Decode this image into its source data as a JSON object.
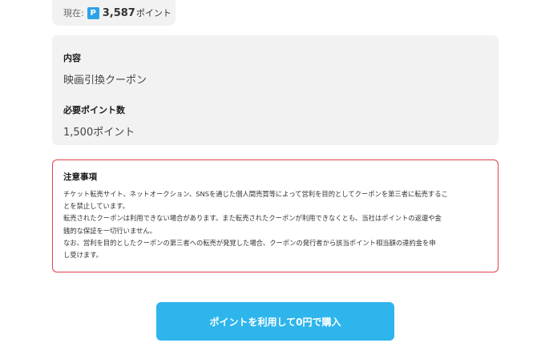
{
  "balance": {
    "label": "現在:",
    "icon_letter": "P",
    "value": "3,587",
    "unit": "ポイント"
  },
  "details": {
    "content_title": "内容",
    "content_value": "映画引換クーポン",
    "points_title": "必要ポイント数",
    "points_value": "1,500ポイント"
  },
  "notice": {
    "title": "注意事項",
    "body": "チケット転売サイト、ネットオークション、SNSを通じた個人間売買等によって営利を目的としてクーポンを第三者に転売するこ\nとを禁止しています。\n転売されたクーポンは利用できない場合があります。また転売されたクーポンが利用できなくとも、当社はポイントの返還や金\n銭的な保証を一切行いません。\nなお、営利を目的としたクーポンの第三者への転売が発覚した場合、クーポンの発行者から該当ポイント相当額の違約金を申\nし受けます。"
  },
  "actions": {
    "buy_label": "ポイントを利用して0円で購入"
  },
  "colors": {
    "accent": "#2eb5ec",
    "point_icon": "#2ea3e6",
    "notice_border": "#e0424e",
    "card_bg": "#f2f2f2"
  }
}
